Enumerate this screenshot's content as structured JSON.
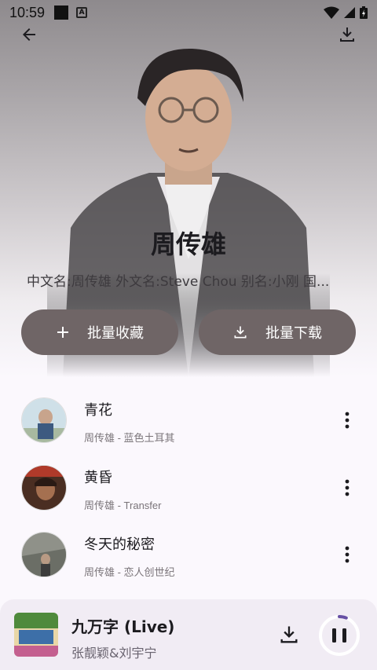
{
  "status_bar": {
    "time": "10:59",
    "badge_letter": "A"
  },
  "artist": {
    "name": "周传雄",
    "info": "中文名:周传雄  外文名:Steve Chou  别名:小刚  国..."
  },
  "actions": {
    "collect_label": "批量收藏",
    "download_label": "批量下载"
  },
  "songs": [
    {
      "title": "青花",
      "subtitle": "周传雄 - 蓝色土耳其"
    },
    {
      "title": "黄昏",
      "subtitle": "周传雄 - Transfer"
    },
    {
      "title": "冬天的秘密",
      "subtitle": "周传雄 - 恋人创世纪"
    }
  ],
  "now_playing": {
    "title": "九万字 (Live)",
    "artist": "张靓颖&刘宇宁",
    "progress": 0.06
  },
  "colors": {
    "button_bg": "#6f6566",
    "player_bg": "#f1ecf4",
    "accent": "#6750a4"
  }
}
